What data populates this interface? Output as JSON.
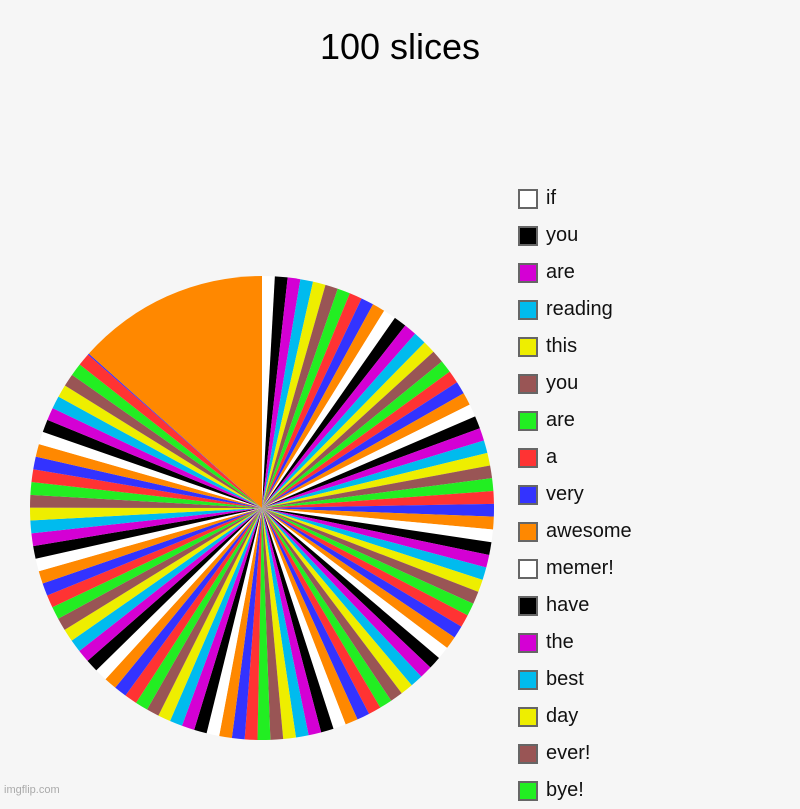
{
  "chart_data": {
    "type": "pie",
    "title": "100 slices",
    "start_angle": "top",
    "direction": "clockwise",
    "palette": [
      "#ffffff",
      "#000000",
      "#d400d4",
      "#00bbee",
      "#eeee00",
      "#995555",
      "#22ee22",
      "#ff3333",
      "#3333ff",
      "#ff8800"
    ],
    "labels": [
      "if",
      "you",
      "are",
      "reading",
      "this",
      "you",
      "are",
      "a",
      "very",
      "awesome",
      "memer!",
      "have",
      "the",
      "best",
      "day",
      "ever!",
      "bye!"
    ],
    "slice_count": 100,
    "small_value": 1,
    "small_slice_count": 98,
    "sliver_value": 0.1,
    "last_value": 15.2,
    "legend_position": "right"
  },
  "watermark": "imgflip.com"
}
